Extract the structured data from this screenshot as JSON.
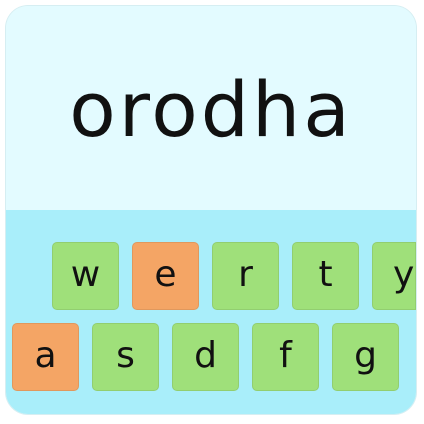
{
  "word": "orodha",
  "colors": {
    "word_background": "#e3fbff",
    "keyboard_background": "#a9eefa",
    "key_default": "#9fe07a",
    "key_highlight": "#f4a565"
  },
  "keyboard": {
    "row1": [
      {
        "label": "w",
        "state": "default"
      },
      {
        "label": "e",
        "state": "highlight"
      },
      {
        "label": "r",
        "state": "default"
      },
      {
        "label": "t",
        "state": "default"
      },
      {
        "label": "y",
        "state": "default"
      }
    ],
    "row2": [
      {
        "label": "a",
        "state": "highlight"
      },
      {
        "label": "s",
        "state": "default"
      },
      {
        "label": "d",
        "state": "default"
      },
      {
        "label": "f",
        "state": "default"
      },
      {
        "label": "g",
        "state": "default"
      }
    ]
  }
}
